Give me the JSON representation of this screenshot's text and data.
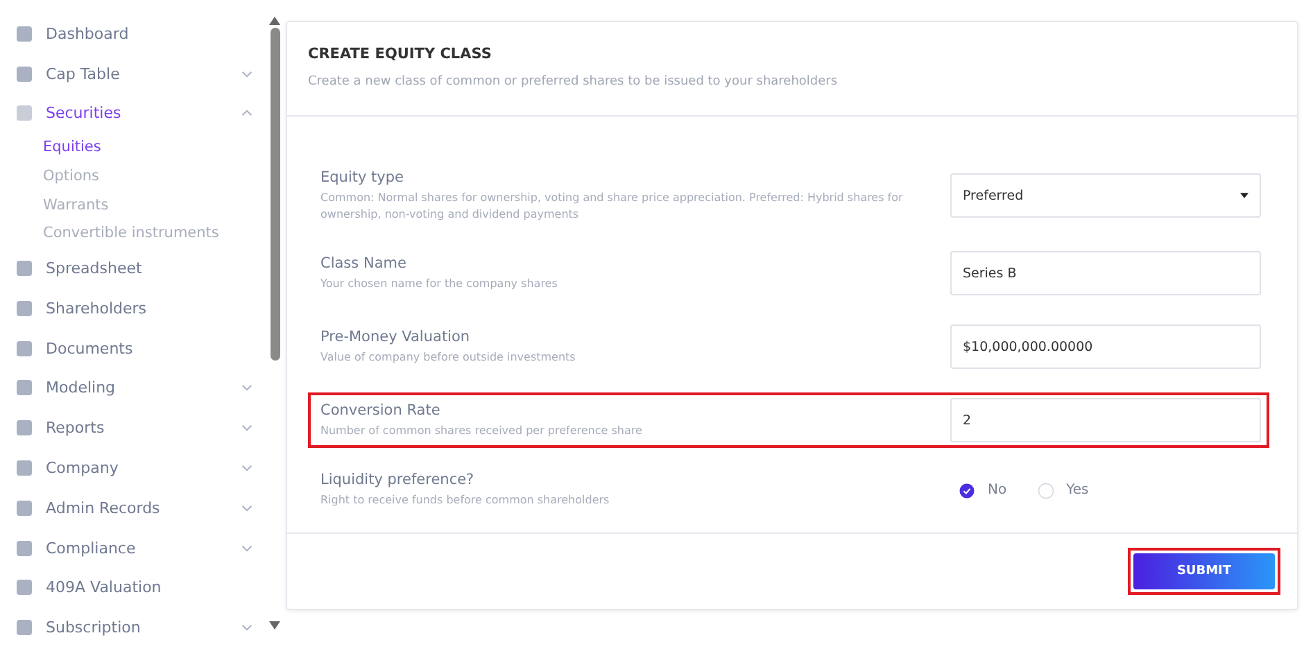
{
  "sidebar": {
    "items": [
      {
        "label": "Dashboard",
        "has_children": false,
        "expanded": false,
        "selected": false
      },
      {
        "label": "Cap Table",
        "has_children": true,
        "expanded": false,
        "selected": false
      },
      {
        "label": "Securities",
        "has_children": true,
        "expanded": true,
        "selected": true,
        "children": [
          {
            "label": "Equities",
            "selected": true
          },
          {
            "label": "Options",
            "selected": false
          },
          {
            "label": "Warrants",
            "selected": false
          },
          {
            "label": "Convertible instruments",
            "selected": false
          }
        ]
      },
      {
        "label": "Spreadsheet",
        "has_children": false,
        "expanded": false,
        "selected": false
      },
      {
        "label": "Shareholders",
        "has_children": false,
        "expanded": false,
        "selected": false
      },
      {
        "label": "Documents",
        "has_children": false,
        "expanded": false,
        "selected": false
      },
      {
        "label": "Modeling",
        "has_children": true,
        "expanded": false,
        "selected": false
      },
      {
        "label": "Reports",
        "has_children": true,
        "expanded": false,
        "selected": false
      },
      {
        "label": "Company",
        "has_children": true,
        "expanded": false,
        "selected": false
      },
      {
        "label": "Admin Records",
        "has_children": true,
        "expanded": false,
        "selected": false
      },
      {
        "label": "Compliance",
        "has_children": true,
        "expanded": false,
        "selected": false
      },
      {
        "label": "409A Valuation",
        "has_children": false,
        "expanded": false,
        "selected": false
      },
      {
        "label": "Subscription",
        "has_children": true,
        "expanded": false,
        "selected": false
      }
    ]
  },
  "form": {
    "title": "CREATE EQUITY CLASS",
    "subtitle": "Create a new class of common or preferred shares to be issued to your shareholders",
    "fields": [
      {
        "kind": "select",
        "label": "Equity type",
        "hint": "Common: Normal shares for ownership, voting and share price appreciation. Preferred: Hybrid shares for ownership, non-voting and dividend payments",
        "value": "Preferred",
        "highlighted": false
      },
      {
        "kind": "text",
        "label": "Class Name",
        "hint": "Your chosen name for the company shares",
        "value": "Series B",
        "highlighted": false
      },
      {
        "kind": "text",
        "label": "Pre-Money Valuation",
        "hint": "Value of company before outside investments",
        "value": "$10,000,000.00000",
        "highlighted": false
      },
      {
        "kind": "text",
        "label": "Conversion Rate",
        "hint": "Number of common shares received per preference share",
        "value": "2",
        "highlighted": true
      },
      {
        "kind": "radio",
        "label": "Liquidity preference?",
        "hint": "Right to receive funds before common shareholders",
        "options": [
          {
            "label": "No",
            "selected": true
          },
          {
            "label": "Yes",
            "selected": false
          }
        ],
        "highlighted": false
      }
    ],
    "submit": {
      "label": "SUBMIT",
      "highlighted": true
    }
  }
}
